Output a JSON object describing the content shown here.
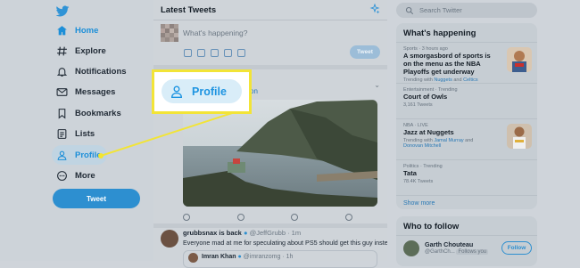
{
  "sidebar": {
    "items": [
      {
        "label": "Home",
        "icon": "home-icon"
      },
      {
        "label": "Explore",
        "icon": "hashtag-icon"
      },
      {
        "label": "Notifications",
        "icon": "bell-icon"
      },
      {
        "label": "Messages",
        "icon": "envelope-icon"
      },
      {
        "label": "Bookmarks",
        "icon": "bookmark-icon"
      },
      {
        "label": "Lists",
        "icon": "list-icon"
      },
      {
        "label": "Profile",
        "icon": "person-icon"
      },
      {
        "label": "More",
        "icon": "more-circle-icon"
      }
    ],
    "tweet_button": "Tweet",
    "active_item": "Profile"
  },
  "main": {
    "title": "Latest Tweets",
    "compose": {
      "placeholder": "What's happening?",
      "tweet_button": "Tweet"
    },
    "card": {
      "fragment": "tion"
    },
    "tweet2": {
      "name": "grubbsnax is back",
      "handle": "@JeffGrubb · 1m",
      "text": "Everyone mad at me for speculating about PS5 should get this guy instead!",
      "quote": {
        "name": "Imran Khan",
        "handle": "@imranzomg · 1h"
      }
    }
  },
  "right": {
    "search_placeholder": "Search Twitter",
    "happening": {
      "title": "What's happening",
      "trends": [
        {
          "meta": "Sports · 3 hours ago",
          "topic": "A smorgasbord of sports is on the menu as the NBA Playoffs get underway",
          "sub_prefix": "Trending with ",
          "sub_links": [
            "Nuggets",
            "Celtics"
          ],
          "sub_join": " and "
        },
        {
          "meta": "Entertainment · Trending",
          "topic": "Court of Owls",
          "count": "3,161 Tweets"
        },
        {
          "meta": "NBA · LIVE",
          "topic": "Jazz at Nuggets",
          "sub_prefix": "Trending with ",
          "sub_links": [
            "Jamal Murray",
            "Donovan Mitchell"
          ],
          "sub_join": " and "
        },
        {
          "meta": "Politics · Trending",
          "topic": "Tata",
          "count": "78.4K Tweets"
        }
      ],
      "show_more": "Show more"
    },
    "who_to_follow": {
      "title": "Who to follow",
      "user": {
        "name": "Garth Chouteau",
        "handle": "@GarthCh...",
        "follows_you": "Follows you",
        "button": "Follow"
      }
    }
  },
  "callout": {
    "label": "Profile"
  },
  "colors": {
    "accent": "#1d94e1",
    "highlight": "#f2e437",
    "tweet_button": "#2d8fd0"
  }
}
